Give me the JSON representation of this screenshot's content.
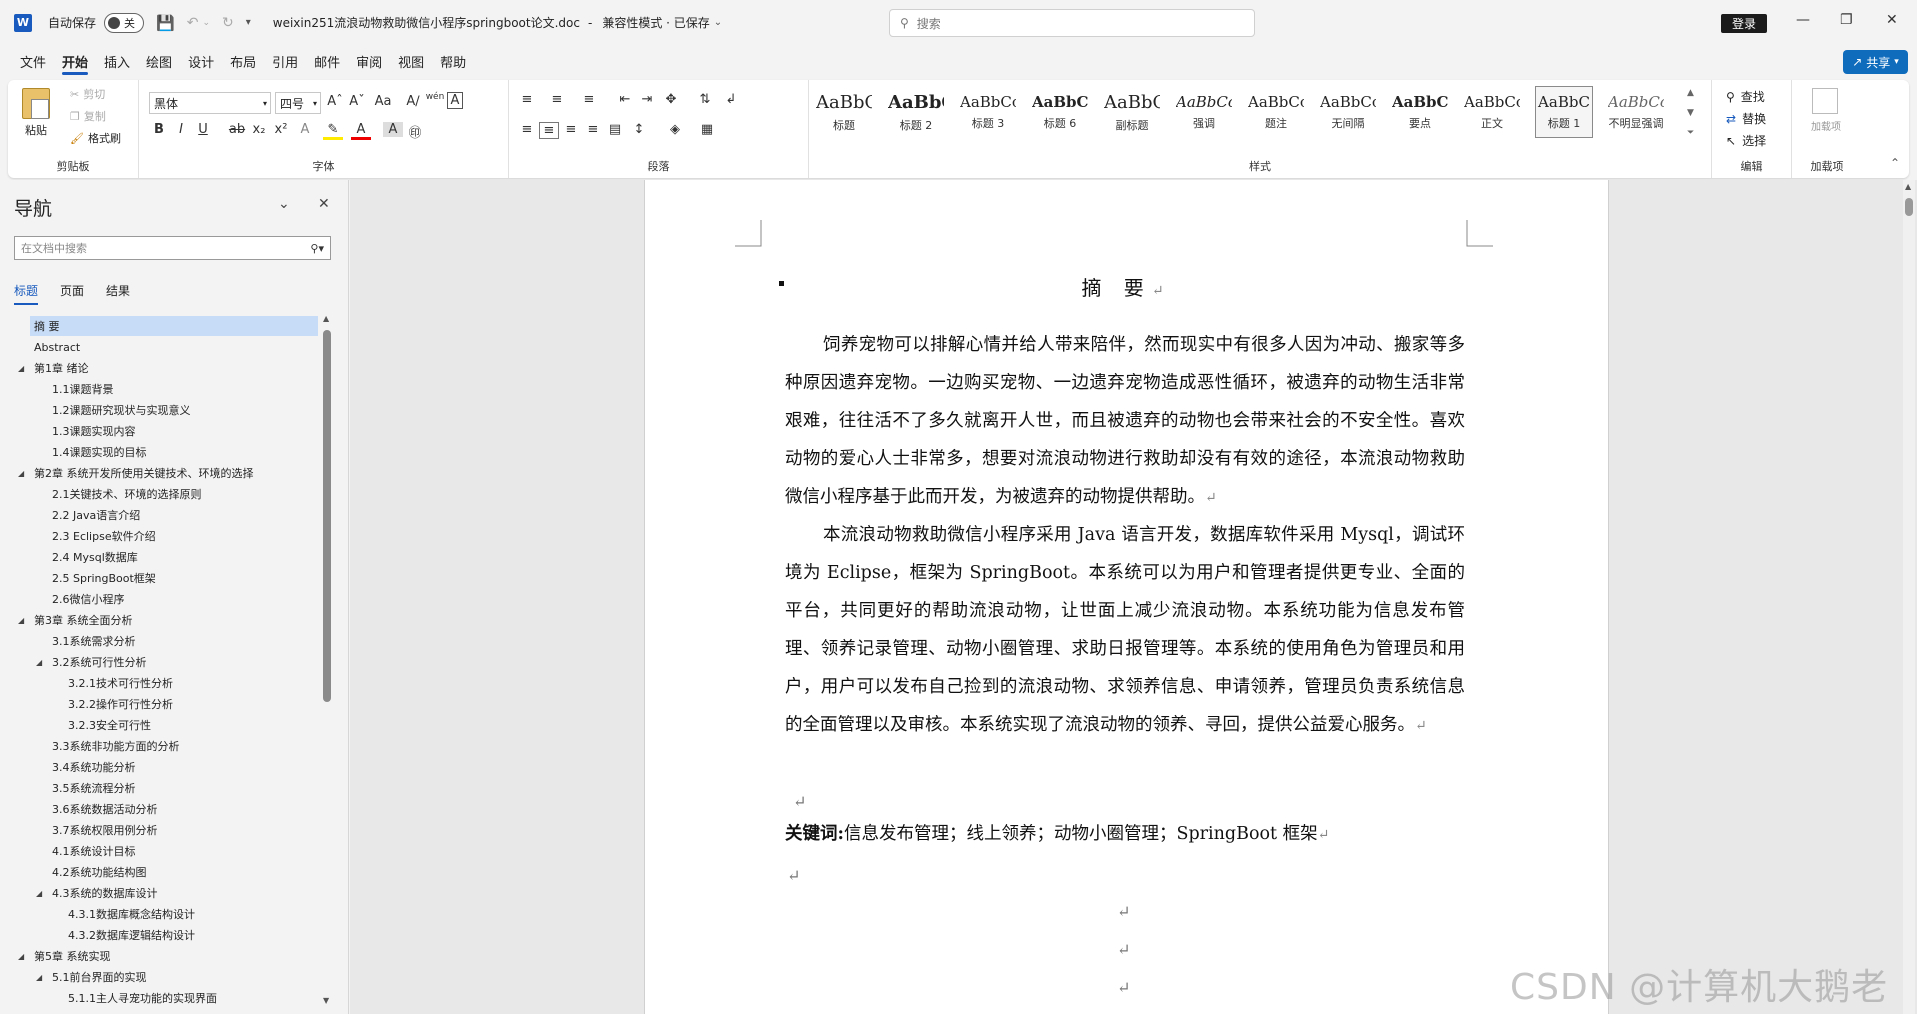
{
  "titlebar": {
    "autosave_label": "自动保存",
    "toggle_state": "关",
    "doc_title": "weixin251流浪动物救助微信小程序springboot论文.doc",
    "separator": "-",
    "compat_mode": "兼容性模式 · 已保存",
    "search_placeholder": "搜索",
    "login": "登录"
  },
  "menu": {
    "tabs": [
      "文件",
      "开始",
      "插入",
      "绘图",
      "设计",
      "布局",
      "引用",
      "邮件",
      "审阅",
      "视图",
      "帮助"
    ],
    "active": "开始",
    "share": "共享"
  },
  "ribbon": {
    "clipboard": {
      "paste": "粘贴",
      "cut": "剪切",
      "copy": "复制",
      "format_painter": "格式刷",
      "label": "剪贴板"
    },
    "font": {
      "name": "黑体",
      "size": "四号",
      "label": "字体"
    },
    "paragraph": {
      "label": "段落"
    },
    "styles": {
      "label": "样式",
      "items": [
        {
          "sample": "AaBbC",
          "name": "标题"
        },
        {
          "sample": "AaBbCc",
          "name": "标题 2"
        },
        {
          "sample": "AaBbCcI",
          "name": "标题 3"
        },
        {
          "sample": "AaBbCcI",
          "name": "标题 6"
        },
        {
          "sample": "AaBbC",
          "name": "副标题"
        },
        {
          "sample": "AaBbCcI",
          "name": "强调"
        },
        {
          "sample": "AaBbCcD",
          "name": "题注"
        },
        {
          "sample": "AaBbCcD",
          "name": "无间隔"
        },
        {
          "sample": "AaBbCcI",
          "name": "要点"
        },
        {
          "sample": "AaBbCcI",
          "name": "正文"
        },
        {
          "sample": "AaBbC",
          "name": "标题 1"
        },
        {
          "sample": "AaBbCcI",
          "name": "不明显强调"
        }
      ]
    },
    "editing": {
      "find": "查找",
      "replace": "替换",
      "select": "选择",
      "label": "编辑"
    },
    "addins": {
      "button": "加载项",
      "label": "加载项"
    }
  },
  "nav": {
    "title": "导航",
    "search_placeholder": "在文档中搜索",
    "tabs": [
      "标题",
      "页面",
      "结果"
    ],
    "items": [
      {
        "text": "摘 要",
        "level": 0
      },
      {
        "text": "Abstract",
        "level": 0
      },
      {
        "text": "第1章 绪论",
        "level": 0,
        "arrow": true
      },
      {
        "text": "1.1课题背景",
        "level": 1
      },
      {
        "text": "1.2课题研究现状与实现意义",
        "level": 1
      },
      {
        "text": "1.3课题实现内容",
        "level": 1
      },
      {
        "text": "1.4课题实现的目标",
        "level": 1
      },
      {
        "text": "第2章 系统开发所使用关键技术、环境的选择",
        "level": 0,
        "arrow": true
      },
      {
        "text": "2.1关键技术、环境的选择原则",
        "level": 1
      },
      {
        "text": "2.2 Java语言介绍",
        "level": 1
      },
      {
        "text": "2.3 Eclipse软件介绍",
        "level": 1
      },
      {
        "text": "2.4 Mysql数据库",
        "level": 1
      },
      {
        "text": "2.5 SpringBoot框架",
        "level": 1
      },
      {
        "text": "2.6微信小程序",
        "level": 1
      },
      {
        "text": "第3章 系统全面分析",
        "level": 0,
        "arrow": true
      },
      {
        "text": "3.1系统需求分析",
        "level": 1
      },
      {
        "text": "3.2系统可行性分析",
        "level": 1,
        "arrow": true
      },
      {
        "text": "3.2.1技术可行性分析",
        "level": 2
      },
      {
        "text": "3.2.2操作可行性分析",
        "level": 2
      },
      {
        "text": "3.2.3安全可行性",
        "level": 2
      },
      {
        "text": "3.3系统非功能方面的分析",
        "level": 1
      },
      {
        "text": "3.4系统功能分析",
        "level": 1
      },
      {
        "text": "3.5系统流程分析",
        "level": 1
      },
      {
        "text": "3.6系统数据活动分析",
        "level": 1
      },
      {
        "text": "3.7系统权限用例分析",
        "level": 1
      },
      {
        "text": "4.1系统设计目标",
        "level": 1
      },
      {
        "text": "4.2系统功能结构图",
        "level": 1
      },
      {
        "text": "4.3系统的数据库设计",
        "level": 1,
        "arrow": true
      },
      {
        "text": "4.3.1数据库概念结构设计",
        "level": 2
      },
      {
        "text": "4.3.2数据库逻辑结构设计",
        "level": 2
      },
      {
        "text": "第5章 系统实现",
        "level": 0,
        "arrow": true
      },
      {
        "text": "5.1前台界面的实现",
        "level": 1,
        "arrow": true
      },
      {
        "text": "5.1.1主人寻宠功能的实现界面",
        "level": 2
      }
    ]
  },
  "document": {
    "abstract_title": "摘 要",
    "para1": "饲养宠物可以排解心情并给人带来陪伴，然而现实中有很多人因为冲动、搬家等多种原因遗弃宠物。一边购买宠物、一边遗弃宠物造成恶性循环，被遗弃的动物生活非常艰难，往往活不了多久就离开人世，而且被遗弃的动物也会带来社会的不安全性。喜欢动物的爱心人士非常多，想要对流浪动物进行救助却没有有效的途径，本流浪动物救助微信小程序基于此而开发，为被遗弃的动物提供帮助。",
    "para2": "本流浪动物救助微信小程序采用 Java 语言开发，数据库软件采用 Mysql，调试环境为 Eclipse，框架为 SpringBoot。本系统可以为用户和管理者提供更专业、全面的平台，共同更好的帮助流浪动物，让世面上减少流浪动物。本系统功能为信息发布管理、领养记录管理、动物小圈管理、求助日报管理等。本系统的使用角色为管理员和用户，用户可以发布自己捡到的流浪动物、求领养信息、申请领养，管理员负责系统信息的全面管理以及审核。本系统实现了流浪动物的领养、寻回，提供公益爱心服务。",
    "keywords_label": "关键词:",
    "keywords": "信息发布管理；线上领养；动物小圈管理；SpringBoot 框架",
    "return_mark": "↵"
  },
  "watermark": "CSDN @计算机大鹅老师"
}
